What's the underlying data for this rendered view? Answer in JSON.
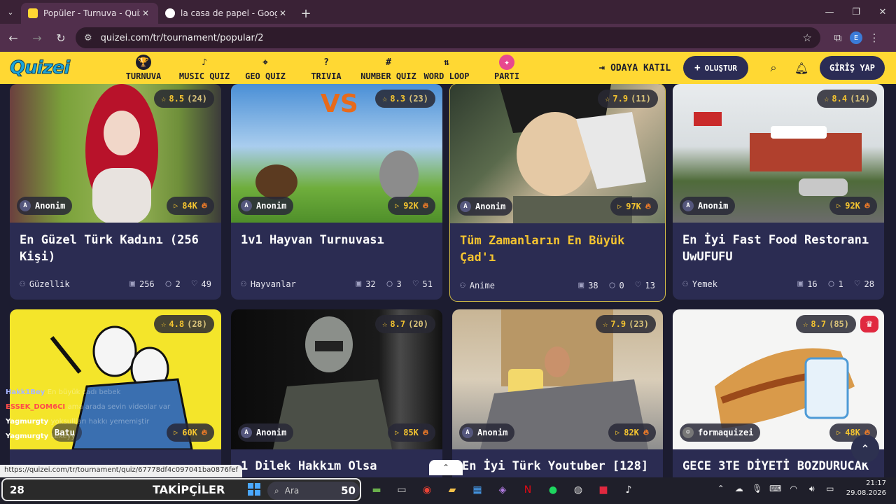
{
  "browser": {
    "tabs": [
      {
        "title": "Popüler - Turnuva - Quizei",
        "active": true
      },
      {
        "title": "la casa de papel - Google'da Ar",
        "active": false
      }
    ],
    "url": "quizei.com/tr/tournament/popular/2",
    "profile_initial": "E",
    "status_url": "https://quizei.com/tr/tournament/quiz/67778df4c097041ba0876fef"
  },
  "site": {
    "logo": "Quizei",
    "nav": [
      {
        "label": "TURNUVA",
        "icon": "trophy-icon",
        "glyph": "🏆"
      },
      {
        "label": "MUSIC QUIZ",
        "icon": "music-note-icon",
        "glyph": "♪"
      },
      {
        "label": "GEO QUIZ",
        "icon": "map-pin-icon",
        "glyph": "⌖"
      },
      {
        "label": "TRIVIA",
        "icon": "question-icon",
        "glyph": "?"
      },
      {
        "label": "NUMBER QUIZ",
        "icon": "hash-icon",
        "glyph": "#"
      },
      {
        "label": "WORD LOOP",
        "icon": "sort-icon",
        "glyph": "⇅"
      },
      {
        "label": "PARTI",
        "icon": "party-icon",
        "glyph": "✦"
      }
    ],
    "join_label": "ODAYA KATIL",
    "create_label": "OLUŞTUR",
    "login_label": "GİRİŞ YAP"
  },
  "cards": [
    {
      "title": "En Güzel Türk Kadını (256 Kişi)",
      "rating": "8.5",
      "rating_count": "(24)",
      "author": "Anonim",
      "author_initial": "A",
      "plays": "84K",
      "category": "Güzellik",
      "items": "256",
      "comments": "2",
      "likes": "49"
    },
    {
      "title": "1v1 Hayvan Turnuvası",
      "rating": "8.3",
      "rating_count": "(23)",
      "author": "Anonim",
      "author_initial": "A",
      "plays": "92K",
      "category": "Hayvanlar",
      "items": "32",
      "comments": "3",
      "likes": "51"
    },
    {
      "title": "Tüm Zamanların En Büyük Çad'ı",
      "rating": "7.9",
      "rating_count": "(11)",
      "author": "Anonim",
      "author_initial": "A",
      "plays": "97K",
      "category": "Anime",
      "items": "38",
      "comments": "0",
      "likes": "13"
    },
    {
      "title": "En İyi Fast Food Restoranı UwUFUFU",
      "rating": "8.4",
      "rating_count": "(14)",
      "author": "Anonim",
      "author_initial": "A",
      "plays": "92K",
      "category": "Yemek",
      "items": "16",
      "comments": "1",
      "likes": "28"
    },
    {
      "title": "",
      "rating": "4.8",
      "rating_count": "(28)",
      "author": "Batu",
      "author_initial": "",
      "plays": "60K"
    },
    {
      "title": "1 Dilek Hakkım Olsa",
      "rating": "8.7",
      "rating_count": "(20)",
      "author": "Anonim",
      "author_initial": "A",
      "plays": "85K"
    },
    {
      "title": "En İyi Türk Youtuber [128]",
      "rating": "7.9",
      "rating_count": "(23)",
      "author": "Anonim",
      "author_initial": "A",
      "plays": "82K"
    },
    {
      "title": "GECE 3TE DİYETİ BOZDURUCAK",
      "rating": "8.7",
      "rating_count": "(85)",
      "author": "formaquizei",
      "author_initial": "",
      "plays": "48K"
    }
  ],
  "chat": [
    {
      "user": "Hakk1Bey",
      "msg": "En büyük cadı bebek"
    },
    {
      "user": "ESSEK_DOM6CI",
      "msg": "ama arada sevin videolar var"
    },
    {
      "user": "Yagmurgty",
      "msg": "yoksullları hakkı yememiştir"
    },
    {
      "user": "Yagmurgty",
      "msg": "Lekeyy"
    }
  ],
  "taskbar": {
    "followers_count": "28",
    "followers_label": "TAKİPÇİLER",
    "search_placeholder": "Ara",
    "search_number": "50",
    "time": "21:17",
    "date": "29.08.2026"
  },
  "colors": {
    "brand_yellow": "#ffd833",
    "card_bg": "#2b2c52",
    "accent_gold": "#f4c430"
  }
}
